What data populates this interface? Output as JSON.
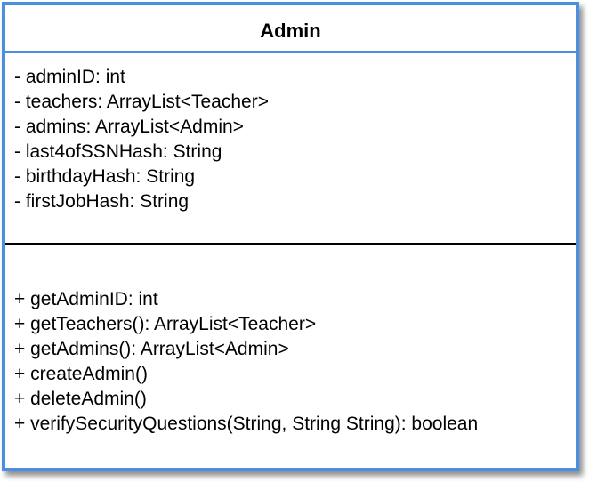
{
  "class_name": "Admin",
  "attributes": [
    "- adminID: int",
    "- teachers: ArrayList<Teacher>",
    "- admins: ArrayList<Admin>",
    "- last4ofSSNHash: String",
    "- birthdayHash: String",
    "- firstJobHash: String"
  ],
  "methods": [
    "+ getAdminID: int",
    "+ getTeachers(): ArrayList<Teacher>",
    "+ getAdmins(): ArrayList<Admin>",
    "+ createAdmin()",
    "+ deleteAdmin()",
    "+ verifySecurityQuestions(String, String String): boolean"
  ],
  "colors": {
    "border": "#4a90e2",
    "text": "#000000",
    "divider": "#000000"
  }
}
